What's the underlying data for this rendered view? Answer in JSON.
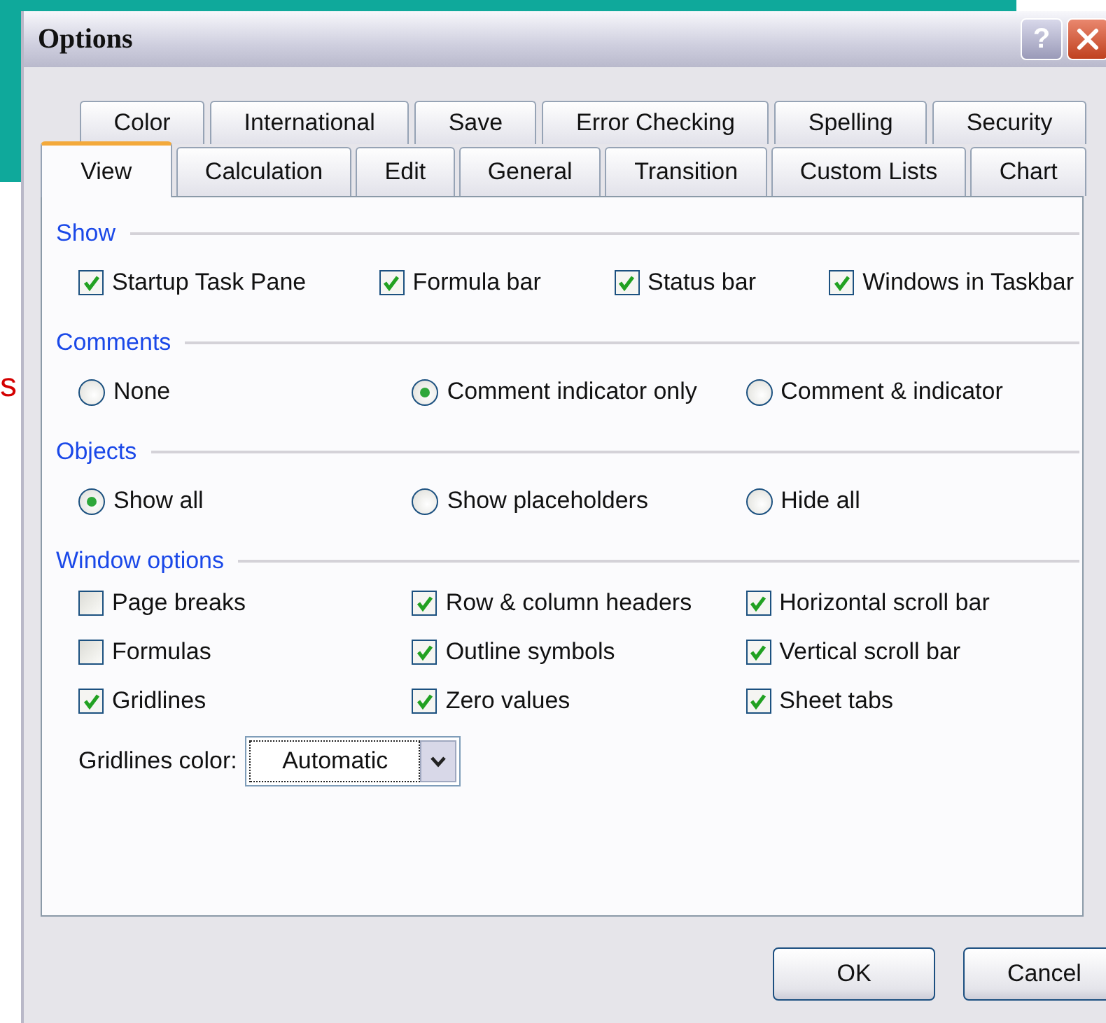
{
  "backdrop": {
    "text_fragment": "s"
  },
  "window": {
    "title": "Options",
    "help_button": "?"
  },
  "tab_rows": [
    [
      {
        "label": "Color",
        "selected": false
      },
      {
        "label": "International",
        "selected": false
      },
      {
        "label": "Save",
        "selected": false
      },
      {
        "label": "Error Checking",
        "selected": false
      },
      {
        "label": "Spelling",
        "selected": false
      },
      {
        "label": "Security",
        "selected": false
      }
    ],
    [
      {
        "label": "View",
        "selected": true
      },
      {
        "label": "Calculation",
        "selected": false
      },
      {
        "label": "Edit",
        "selected": false
      },
      {
        "label": "General",
        "selected": false
      },
      {
        "label": "Transition",
        "selected": false
      },
      {
        "label": "Custom Lists",
        "selected": false
      },
      {
        "label": "Chart",
        "selected": false
      }
    ]
  ],
  "sections": [
    {
      "title": "Show",
      "kind": "checkboxes",
      "items": [
        {
          "label": "Startup Task Pane",
          "checked": true
        },
        {
          "label": "Formula bar",
          "checked": true
        },
        {
          "label": "Status bar",
          "checked": true
        },
        {
          "label": "Windows in Taskbar",
          "checked": true
        }
      ]
    },
    {
      "title": "Comments",
      "kind": "radios",
      "items": [
        {
          "label": "None",
          "selected": false
        },
        {
          "label": "Comment indicator only",
          "selected": true
        },
        {
          "label": "Comment & indicator",
          "selected": false
        }
      ]
    },
    {
      "title": "Objects",
      "kind": "radios",
      "items": [
        {
          "label": "Show all",
          "selected": true
        },
        {
          "label": "Show placeholders",
          "selected": false
        },
        {
          "label": "Hide all",
          "selected": false
        }
      ]
    },
    {
      "title": "Window options",
      "kind": "grid",
      "columns": [
        [
          {
            "label": "Page breaks",
            "checked": false
          },
          {
            "label": "Formulas",
            "checked": false
          },
          {
            "label": "Gridlines",
            "checked": true
          }
        ],
        [
          {
            "label": "Row & column headers",
            "checked": true
          },
          {
            "label": "Outline symbols",
            "checked": true
          },
          {
            "label": "Zero values",
            "checked": true
          }
        ],
        [
          {
            "label": "Horizontal scroll bar",
            "checked": true
          },
          {
            "label": "Vertical scroll bar",
            "checked": true
          },
          {
            "label": "Sheet tabs",
            "checked": true
          }
        ]
      ],
      "dropdown": {
        "label": "Gridlines color:",
        "value": "Automatic"
      }
    }
  ],
  "buttons": [
    "OK",
    "Cancel"
  ]
}
